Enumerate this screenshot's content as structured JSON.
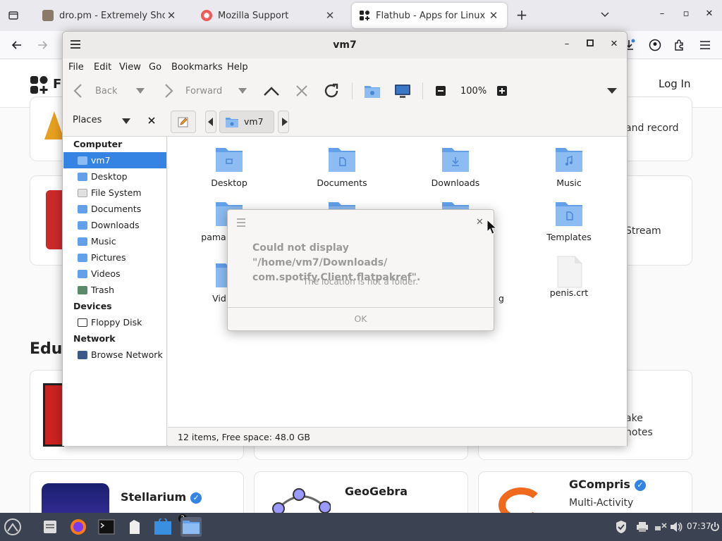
{
  "browser": {
    "tabs": [
      {
        "title": "dro.pm - Extremely Short Link",
        "close": "✕"
      },
      {
        "title": "Mozilla Support",
        "close": "✕"
      },
      {
        "title": "Flathub - Apps for Linux",
        "close": "✕"
      }
    ],
    "new_tab": "+",
    "window_controls": {
      "minimize": "–",
      "maximize": "▫",
      "close": "✕"
    }
  },
  "flathub": {
    "logo_text": "Fl",
    "login": "Log In",
    "card_texts": {
      "record": "and record",
      "stream": "Stream",
      "take": "ake",
      "notes": "notes"
    },
    "section_heading": "Edu",
    "apps": [
      {
        "name": "Stellarium"
      },
      {
        "name": "GeoGebra"
      },
      {
        "name": "GCompris",
        "subtitle": "Multi-Activity"
      }
    ]
  },
  "filemanager": {
    "title": "vm7",
    "menu": [
      "File",
      "Edit",
      "View",
      "Go",
      "Bookmarks",
      "Help"
    ],
    "toolbar": {
      "back": "Back",
      "forward": "Forward",
      "zoom": "100%"
    },
    "places_label": "Places",
    "location_crumb": "vm7",
    "sidebar": {
      "computer_label": "Computer",
      "computer": [
        "vm7",
        "Desktop",
        "File System",
        "Documents",
        "Downloads",
        "Music",
        "Pictures",
        "Videos",
        "Trash"
      ],
      "devices_label": "Devices",
      "devices": [
        "Floppy Disk"
      ],
      "network_label": "Network",
      "network": [
        "Browse Network"
      ]
    },
    "files": [
      {
        "name": "Desktop"
      },
      {
        "name": "Documents"
      },
      {
        "name": "Downloads"
      },
      {
        "name": "Music"
      },
      {
        "name": "pama"
      },
      {
        "name": "Templates"
      },
      {
        "name": "Vid"
      },
      {
        "name": "g"
      },
      {
        "name": "penis.crt"
      }
    ],
    "status": "12 items, Free space: 48.0 GB"
  },
  "dialog": {
    "title": "Could not display \"/home/vm7/Downloads/ com.spotify.Client.flatpakref\".",
    "message": "The location is not a folder.",
    "ok": "OK",
    "close": "✕"
  },
  "taskbar": {
    "badge": "2",
    "clock": "07:37"
  },
  "colors": {
    "accent": "#3584e4",
    "folder": "#62a0ea",
    "taskbar": "#3b4252"
  }
}
